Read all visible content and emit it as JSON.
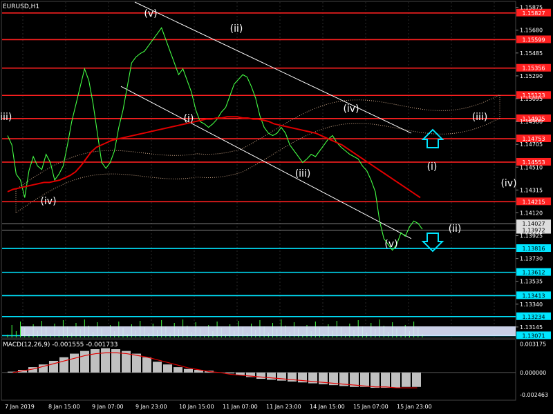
{
  "symbol_title": "EURUSD,H1",
  "indicator_label": "MACD(12,26,9) -0.001555 -0.001733",
  "colors": {
    "background": "#000000",
    "grid": "#2a2a2a",
    "price_line": "#44ff44",
    "resistance": "#ff2020",
    "support": "#00e5ff",
    "ma_red": "#e00000",
    "ma_blue": "#2a3bff",
    "channel": "#ffffff",
    "macd_hist": "#c0c0c0",
    "macd_signal": "#e00000",
    "axis_text": "#ffffff"
  },
  "wave_labels": [
    "(v)",
    "(ii)",
    "(i)",
    "(iv)",
    "(iii)",
    "(iv)",
    "(iii)",
    "(v)",
    "(i)",
    "(ii)",
    "(iii)",
    "(iv)"
  ],
  "arrows": [
    "up-arrow-icon",
    "down-arrow-icon"
  ],
  "chart_data": [
    {
      "type": "line",
      "title": "EURUSD,H1",
      "y_ticks": [
        "1.15875",
        "1.15680",
        "1.15485",
        "1.15290",
        "1.15095",
        "1.14900",
        "1.14705",
        "1.14510",
        "1.14315",
        "1.14120",
        "1.13925",
        "1.13730",
        "1.13535",
        "1.13340",
        "1.13145"
      ],
      "x_ticks": [
        "7 Jan 2019",
        "8 Jan 15:00",
        "9 Jan 07:00",
        "9 Jan 23:00",
        "10 Jan 15:00",
        "11 Jan 07:00",
        "11 Jan 23:00",
        "14 Jan 15:00",
        "15 Jan 07:00",
        "15 Jan 23:00"
      ],
      "ylim": [
        1.1305,
        1.1592
      ],
      "resistance_levels": [
        "1.15827",
        "1.15599",
        "1.15356",
        "1.15123",
        "1.14925",
        "1.14753",
        "1.14553",
        "1.14215"
      ],
      "current_prices": [
        "1.14027",
        "1.13972"
      ],
      "support_levels": [
        "1.13816",
        "1.13612",
        "1.13413",
        "1.13234",
        "1.13071"
      ],
      "price_series": [
        1.1478,
        1.147,
        1.1445,
        1.144,
        1.1425,
        1.1448,
        1.146,
        1.1452,
        1.1449,
        1.1462,
        1.1455,
        1.144,
        1.1445,
        1.1452,
        1.147,
        1.149,
        1.1505,
        1.152,
        1.1535,
        1.1525,
        1.1505,
        1.148,
        1.1455,
        1.145,
        1.1455,
        1.1465,
        1.1485,
        1.15,
        1.152,
        1.154,
        1.1545,
        1.1548,
        1.155,
        1.1555,
        1.156,
        1.1565,
        1.157,
        1.156,
        1.155,
        1.154,
        1.153,
        1.1535,
        1.1525,
        1.1515,
        1.15,
        1.149,
        1.1488,
        1.1485,
        1.1488,
        1.1492,
        1.1498,
        1.1502,
        1.1512,
        1.1522,
        1.1526,
        1.153,
        1.1528,
        1.152,
        1.151,
        1.1495,
        1.1485,
        1.148,
        1.1478,
        1.148,
        1.1485,
        1.148,
        1.147,
        1.1465,
        1.146,
        1.1455,
        1.1458,
        1.1462,
        1.146,
        1.1465,
        1.147,
        1.1475,
        1.1478,
        1.1472,
        1.1468,
        1.1465,
        1.1462,
        1.146,
        1.1458,
        1.1452,
        1.1448,
        1.144,
        1.143,
        1.1405,
        1.139,
        1.1385,
        1.138,
        1.1385,
        1.1395,
        1.1392,
        1.14,
        1.1405,
        1.1403,
        1.1398
      ],
      "ma_red_series": [
        1.143,
        1.1432,
        1.1433,
        1.1434,
        1.1435,
        1.1436,
        1.1437,
        1.1438,
        1.1438,
        1.1439,
        1.144,
        1.1442,
        1.1444,
        1.1447,
        1.1452,
        1.1458,
        1.1464,
        1.1468,
        1.147,
        1.1472,
        1.1474,
        1.1475,
        1.1476,
        1.1477,
        1.1478,
        1.1479,
        1.148,
        1.1481,
        1.1482,
        1.1483,
        1.1484,
        1.1485,
        1.1486,
        1.1487,
        1.1488,
        1.1489,
        1.149,
        1.1491,
        1.1492,
        1.1492,
        1.1493,
        1.1493,
        1.1494,
        1.1494,
        1.1494,
        1.1493,
        1.1493,
        1.1492,
        1.1492,
        1.1491,
        1.149,
        1.1488,
        1.1487,
        1.1486,
        1.1485,
        1.1484,
        1.1483,
        1.1482,
        1.1481,
        1.148,
        1.1478,
        1.1476,
        1.1474,
        1.1472,
        1.147,
        1.1467,
        1.1464,
        1.1461,
        1.1458,
        1.1455,
        1.1452,
        1.1449,
        1.1446,
        1.1443,
        1.144,
        1.1437,
        1.1434,
        1.1431,
        1.1428,
        1.1425
      ],
      "channel_upper": [
        [
          1.1592,
          1.148
        ]
      ],
      "channel_lower": [
        [
          1.152,
          1.139
        ]
      ]
    },
    {
      "type": "bar",
      "title": "MACD(12,26,9) -0.001555 -0.001733",
      "y_ticks": [
        "0.003175",
        "0.000000",
        "-0.002463"
      ],
      "ylim": [
        -0.003,
        0.0036
      ],
      "histogram": [
        0.0001,
        0.0003,
        0.0006,
        0.0009,
        0.0013,
        0.0017,
        0.0021,
        0.0024,
        0.0026,
        0.0027,
        0.0026,
        0.0024,
        0.0021,
        0.0017,
        0.0012,
        0.0009,
        0.0006,
        0.0004,
        0.0003,
        0.0002,
        0.0,
        -0.0001,
        -0.0003,
        -0.0005,
        -0.0007,
        -0.0008,
        -0.0009,
        -0.001,
        -0.0011,
        -0.0012,
        -0.0013,
        -0.0014,
        -0.0015,
        -0.0016,
        -0.0016,
        -0.0017,
        -0.0017,
        -0.0017,
        -0.0016,
        -0.0016
      ],
      "signal": [
        0.0,
        0.0002,
        0.0004,
        0.0007,
        0.001,
        0.0013,
        0.0016,
        0.0019,
        0.0021,
        0.0022,
        0.0022,
        0.0021,
        0.0019,
        0.0017,
        0.0014,
        0.0011,
        0.0008,
        0.0005,
        0.0003,
        0.0001,
        0.0,
        -0.0002,
        -0.0003,
        -0.0004,
        -0.0005,
        -0.0006,
        -0.0007,
        -0.0008,
        -0.0009,
        -0.001,
        -0.0011,
        -0.0012,
        -0.0013,
        -0.0014,
        -0.0015,
        -0.0016,
        -0.0016,
        -0.0017,
        -0.0017,
        -0.0017
      ]
    }
  ]
}
